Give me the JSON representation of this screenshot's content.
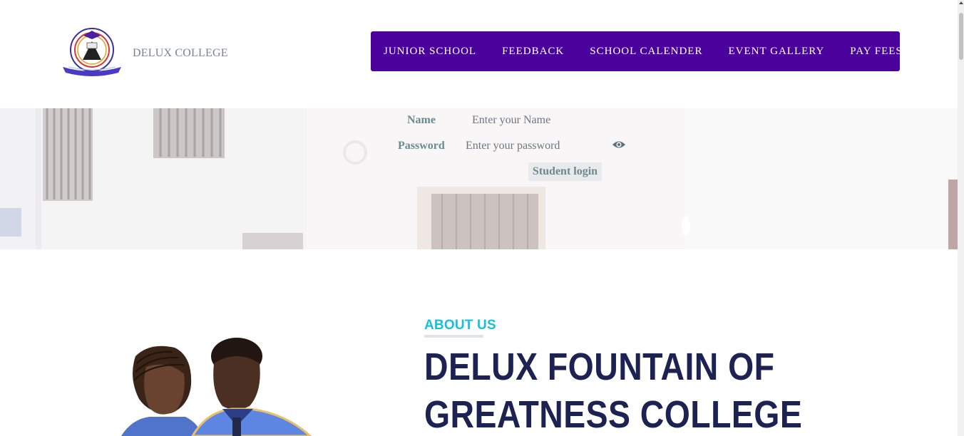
{
  "brand": {
    "name": "DELUX COLLEGE"
  },
  "nav": {
    "items": [
      {
        "label": "JUNIOR SCHOOL"
      },
      {
        "label": "FEEDBACK"
      },
      {
        "label": "SCHOOL CALENDER"
      },
      {
        "label": "EVENT GALLERY"
      },
      {
        "label": "PAY FEES"
      }
    ]
  },
  "login": {
    "name_label": "Name",
    "name_placeholder": "Enter your Name",
    "password_label": "Password",
    "password_placeholder": "Enter your password",
    "submit_label": "Student login"
  },
  "about": {
    "tag": "ABOUT US",
    "title": "DELUX FOUNTAIN OF GREATNESS COLLEGE"
  },
  "colors": {
    "nav_bg": "#4b029c",
    "accent": "#17c1d6",
    "heading": "#1c2353",
    "label": "#6b8a8f"
  },
  "icons": [
    "college-logo",
    "eye-icon"
  ]
}
